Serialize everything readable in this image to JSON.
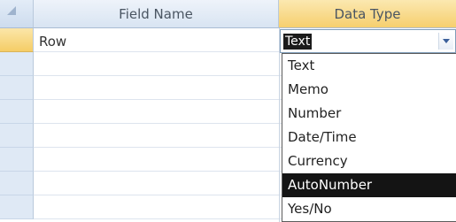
{
  "header": {
    "field_name": "Field Name",
    "data_type": "Data Type"
  },
  "rows": [
    {
      "field_name": "Row",
      "data_type": "Text"
    }
  ],
  "dropdown": {
    "options": [
      "Text",
      "Memo",
      "Number",
      "Date/Time",
      "Currency",
      "AutoNumber",
      "Yes/No"
    ],
    "highlighted": "AutoNumber"
  },
  "colors": {
    "active_header": "#f6cf6e",
    "selection": "#141414"
  }
}
